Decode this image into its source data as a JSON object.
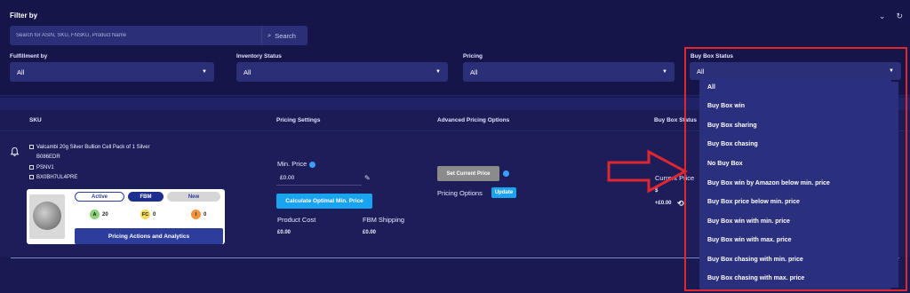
{
  "filter": {
    "title": "Filter by",
    "search_placeholder": "Search for ASIN, SKU, FNSKU, Product Name",
    "search_button": "Search",
    "fulfillment": {
      "label": "Fulfillment by",
      "value": "All"
    },
    "inventory": {
      "label": "Inventory Status",
      "value": "All"
    },
    "pricing": {
      "label": "Pricing",
      "value": "All"
    },
    "buybox": {
      "label": "Buy Box Status",
      "value": "All"
    }
  },
  "table": {
    "headers": {
      "sku": "SKU",
      "pricing_settings": "Pricing Settings",
      "advanced": "Advanced Pricing Options",
      "buybox": "Buy Box Status"
    },
    "row": {
      "title": "Valcambi 20g Silver Bullion Cell Pack of 1 Silver",
      "asin": "B086EDR",
      "sku": "PSNV1",
      "fnsku": "BX0BH7UL4PRE",
      "status_active": "Active",
      "status_fbm": "FBM",
      "status_new": "New",
      "badge_a_letter": "A",
      "badge_a_value": "20",
      "badge_fc_letter": "FC",
      "badge_fc_value": "0",
      "badge_i_letter": "I",
      "badge_i_value": "0",
      "actions_button": "Pricing Actions and Analytics",
      "min_price_label": "Min. Price",
      "min_price_value": "£0.00",
      "calc_button": "Calculate Optimal Min. Price",
      "product_cost_label": "Product Cost",
      "product_cost_value": "£0.00",
      "fbm_shipping_label": "FBM Shipping",
      "fbm_shipping_value": "£0.00",
      "set_current_price": "Set Current Price",
      "pricing_options_label": "Pricing Options",
      "update_button": "Update",
      "current_price_label": "Current Price",
      "current_price_symbol": "$",
      "current_price_shipping": "+£0.00"
    }
  },
  "buybox_options": [
    "All",
    "Buy Box win",
    "Buy Box sharing",
    "Buy Box chasing",
    "No Buy Box",
    "Buy Box win by Amazon below min. price",
    "Buy Box price below min. price",
    "Buy Box win with min. price",
    "Buy Box win with max. price",
    "Buy Box chasing with min. price",
    "Buy Box chasing with max. price"
  ],
  "colors": {
    "accent": "#1aa3ef",
    "highlight": "#e0262f",
    "background": "#1a1a52"
  }
}
